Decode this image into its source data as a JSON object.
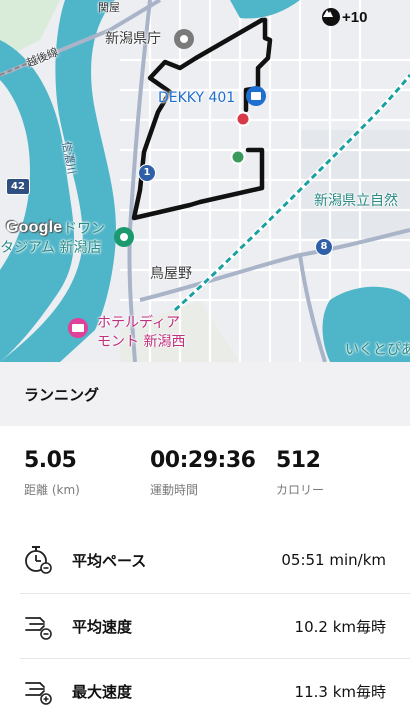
{
  "map": {
    "labels": {
      "kanzaki": "関屋",
      "prefectural_office": "新潟県庁",
      "echigo_line": "越後線",
      "shinano_river": "信濃川",
      "dekky": "DEKKY 401",
      "art_museum": "新潟県立自然",
      "stadium_line1": "ドワン",
      "stadium_line2": "タジアム 新潟店",
      "toriyano": "鳥屋野",
      "hotel_line1": "ホテルディア",
      "hotel_line2": "モント 新潟西",
      "ikutopia": "いくとぴあ",
      "route_42": "42",
      "route_1": "1",
      "route_8": "8",
      "google": "Google"
    },
    "badge": {
      "icon": "summit-icon",
      "value": "+10"
    },
    "colors": {
      "water": "#4fb5c9",
      "route": "#111111",
      "start_marker": "#3a9a5b",
      "end_marker": "#d93a4a",
      "railway": "#1aa0a0"
    }
  },
  "activity": {
    "title": "ランニング"
  },
  "stats": [
    {
      "value": "5.05",
      "label": "距離 (km)"
    },
    {
      "value": "00:29:36",
      "label": "運動時間"
    },
    {
      "value": "512",
      "label": "カロリー"
    }
  ],
  "metrics": [
    {
      "icon": "stopwatch-icon",
      "label": "平均ペース",
      "value": "05:51 min/km"
    },
    {
      "icon": "speed-average-icon",
      "label": "平均速度",
      "value": "10.2 km毎時"
    },
    {
      "icon": "speed-max-icon",
      "label": "最大速度",
      "value": "11.3 km毎時"
    }
  ]
}
